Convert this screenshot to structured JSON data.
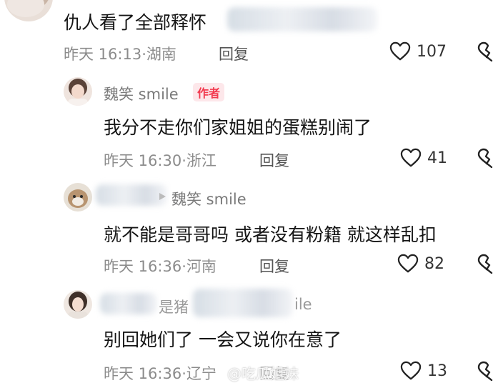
{
  "comments": [
    {
      "text": "仇人看了全部释怀",
      "time": "昨天 16:13",
      "location": "湖南",
      "reply_label": "回复",
      "likes": "107"
    },
    {
      "author": "魏笑 smile",
      "author_badge": "作者",
      "text": "我分不走你们家姐姐的蛋糕别闹了",
      "time": "昨天 16:30",
      "location": "浙江",
      "reply_label": "回复",
      "likes": "41"
    },
    {
      "reply_to": "魏笑 smile",
      "text": "就不能是哥哥吗 或者没有粉籍 就这样乱扣",
      "time": "昨天 16:36",
      "location": "河南",
      "reply_label": "回复",
      "likes": "82"
    },
    {
      "author_partial_1": "是猪",
      "author_partial_2": "ile",
      "text": "别回她们了 一会又说你在意了",
      "time": "昨天 16:36",
      "location": "辽宁",
      "reply_label": "回复",
      "likes": "13"
    }
  ],
  "meta_separator": "·",
  "watermark": "@吃瓜姐妹",
  "colors": {
    "author_badge_text": "#f23a4f",
    "author_badge_bg": "#fde7ea",
    "meta_text": "#8c8c8c"
  },
  "icons": [
    "heart-outline-icon",
    "dislike-heart-icon"
  ]
}
